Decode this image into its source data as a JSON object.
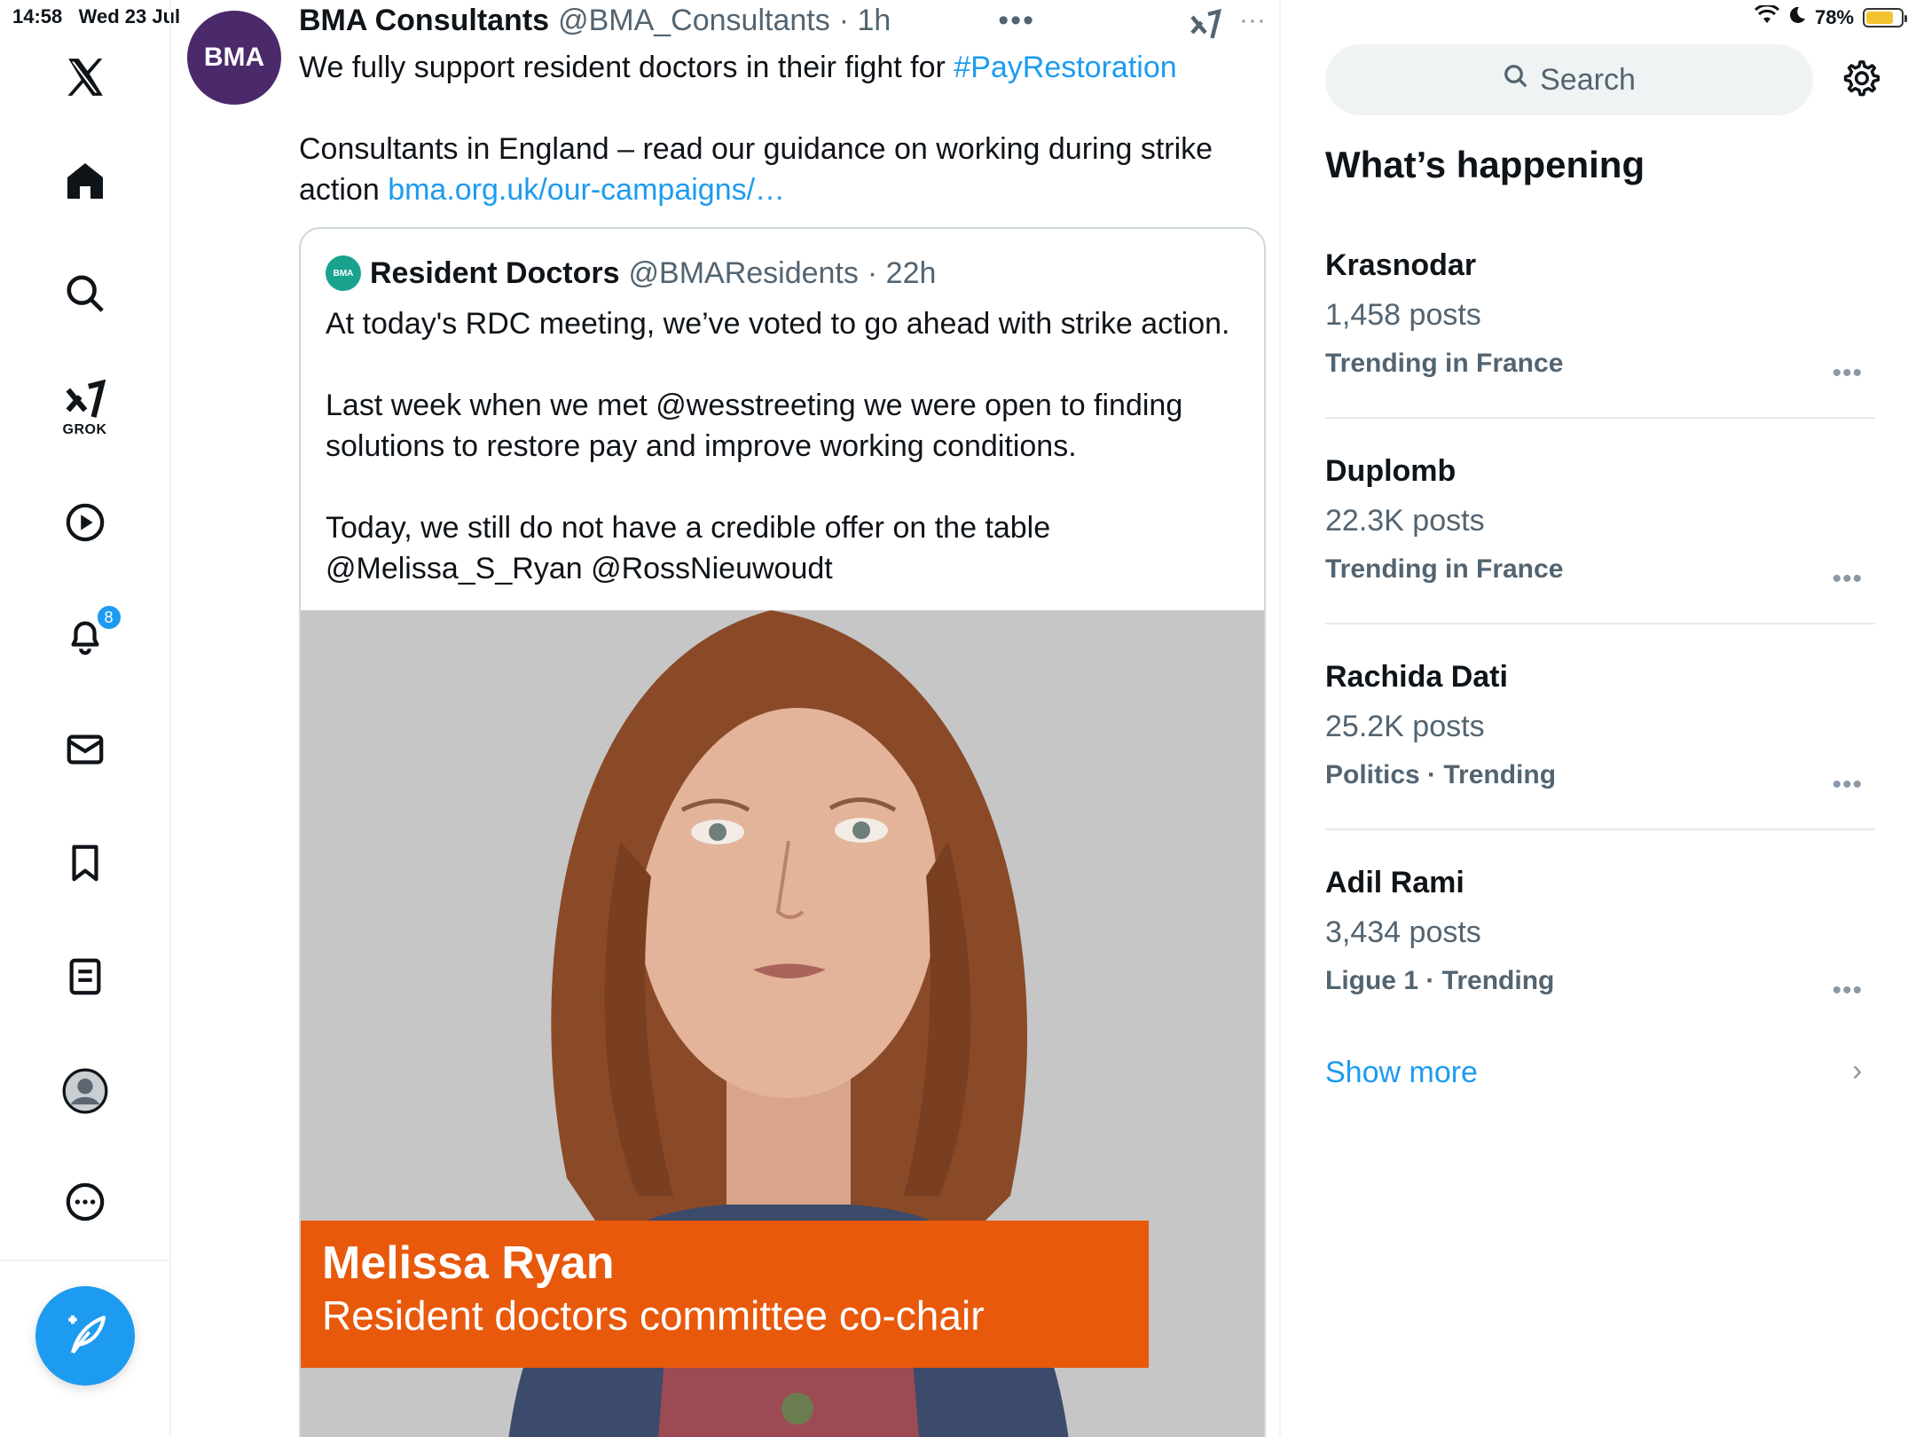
{
  "status_bar": {
    "time": "14:58",
    "date": "Wed 23 Jul",
    "battery": "78%",
    "battery_level": 0.78
  },
  "nav": {
    "grok_label": "GROK",
    "notifications_count": "8",
    "icons": [
      "x-logo-icon",
      "home-icon",
      "search-icon",
      "grok-icon",
      "video-icon",
      "bell-icon",
      "mail-icon",
      "bookmark-icon",
      "lists-icon",
      "profile-icon",
      "more-icon",
      "compose-icon"
    ]
  },
  "tweet": {
    "avatar_text": "BMA",
    "name": "BMA Consultants",
    "handle": "@BMA_Consultants",
    "time": "· 1h",
    "more": "•••",
    "text_before_tag": "We fully support resident doctors in their fight for ",
    "hashtag": "#PayRestoration",
    "text_para2": "Consultants in England – read our guidance on working during strike action ",
    "link": "bma.org.uk/our-campaigns/…",
    "quote": {
      "avatar_text": "BMA",
      "name": "Resident Doctors",
      "handle": "@BMAResidents",
      "time": "· 22h",
      "text": "At today's RDC meeting, we’ve voted to go ahead with strike action.\n\nLast week when we met @wesstreeting we were open to finding solutions to restore pay and improve working conditions.\n\nToday, we still do not have a credible offer on the table @Melissa_S_Ryan @RossNieuwoudt",
      "media": {
        "lower_third_name": "Melissa Ryan",
        "lower_third_title": "Resident doctors committee co-chair"
      }
    }
  },
  "sidebar": {
    "search_placeholder": "Search",
    "section_title": "What’s happening",
    "trends": [
      {
        "name": "Krasnodar",
        "count": "1,458 posts",
        "context": "Trending in France",
        "more": "•••"
      },
      {
        "name": "Duplomb",
        "count": "22.3K posts",
        "context": "Trending in France",
        "more": "•••"
      },
      {
        "name": "Rachida Dati",
        "count": "25.2K posts",
        "context": "Politics · Trending",
        "more": "•••"
      },
      {
        "name": "Adil Rami",
        "count": "3,434 posts",
        "context": "Ligue 1 · Trending",
        "more": "•••"
      }
    ],
    "show_more": "Show more",
    "show_more_chevron": "›"
  },
  "colors": {
    "accent": "#1d9bf0",
    "bma_purple": "#4b2a6b",
    "lower_third_orange": "#e8590c"
  }
}
